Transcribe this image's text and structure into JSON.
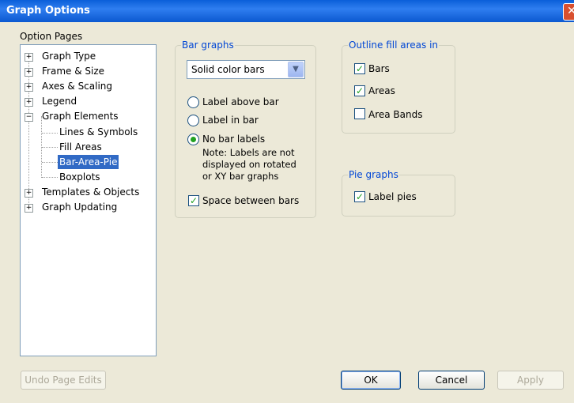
{
  "window": {
    "title": "Graph Options",
    "close_glyph": "✕"
  },
  "option_pages": {
    "label": "Option Pages",
    "items": [
      {
        "label": "Graph Type",
        "expander": "+"
      },
      {
        "label": "Frame & Size",
        "expander": "+"
      },
      {
        "label": "Axes & Scaling",
        "expander": "+"
      },
      {
        "label": "Legend",
        "expander": "+"
      },
      {
        "label": "Graph Elements",
        "expander": "−"
      },
      {
        "label": "Lines & Symbols"
      },
      {
        "label": "Fill Areas"
      },
      {
        "label": "Bar-Area-Pie",
        "selected": true
      },
      {
        "label": "Boxplots"
      },
      {
        "label": "Templates & Objects",
        "expander": "+"
      },
      {
        "label": "Graph Updating",
        "expander": "+"
      }
    ]
  },
  "bar_graphs": {
    "legend": "Bar graphs",
    "style_select": {
      "value": "Solid color bars",
      "arrow": "▼"
    },
    "radios": [
      {
        "label": "Label above bar",
        "checked": false
      },
      {
        "label": "Label in bar",
        "checked": false
      },
      {
        "label": "No bar labels",
        "checked": true
      }
    ],
    "note_lines": [
      "Note: Labels are not",
      "displayed on rotated",
      "or XY bar graphs"
    ],
    "space_between": {
      "label": "Space between bars",
      "checked": true
    }
  },
  "outline_fill": {
    "legend": "Outline fill areas in",
    "checks": [
      {
        "label": "Bars",
        "checked": true
      },
      {
        "label": "Areas",
        "checked": true
      },
      {
        "label": "Area Bands",
        "checked": false
      }
    ]
  },
  "pie_graphs": {
    "legend": "Pie graphs",
    "label_pies": {
      "label": "Label pies",
      "checked": true
    }
  },
  "check_glyph": "✓",
  "buttons": {
    "undo": "Undo Page Edits",
    "ok": "OK",
    "cancel": "Cancel",
    "apply": "Apply"
  },
  "colors": {
    "title_bar": "#0A5FD9",
    "selection": "#316AC5",
    "group_legend": "#0046D5",
    "check": "#21A121"
  }
}
